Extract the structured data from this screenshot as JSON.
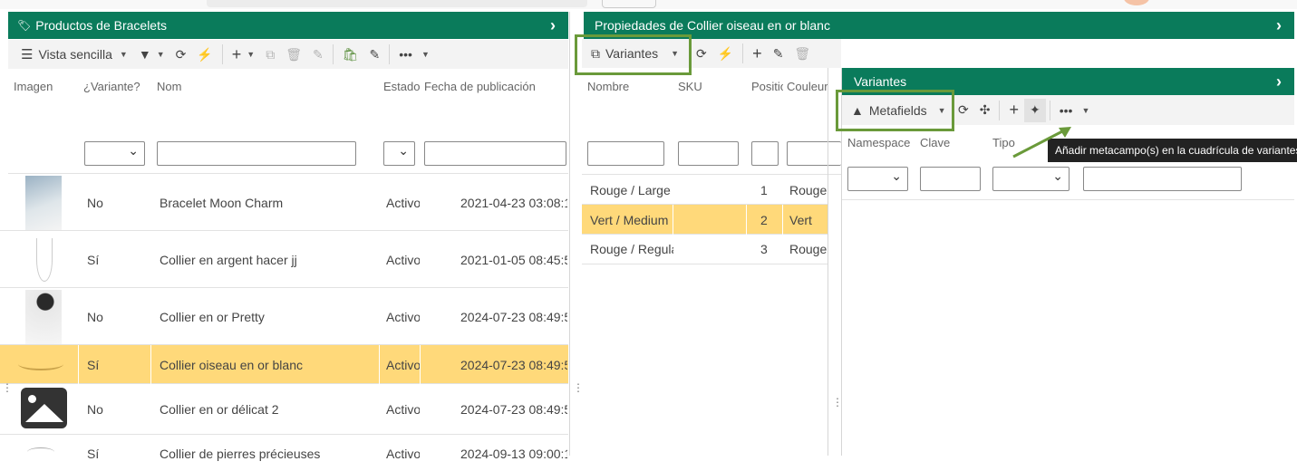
{
  "left_panel": {
    "title": "Productos de Bracelets",
    "toolbar": {
      "view_label": "Vista sencilla"
    },
    "columns": [
      "Imagen",
      "¿Variante?",
      "Nom",
      "Estado",
      "Fecha de publicación"
    ],
    "rows": [
      {
        "variant": "No",
        "name": "Bracelet Moon Charm",
        "status": "Activo",
        "date": "2021-04-23 03:08:1"
      },
      {
        "variant": "Sí",
        "name": "Collier en argent hacer jj",
        "status": "Activo",
        "date": "2021-01-05 08:45:5"
      },
      {
        "variant": "No",
        "name": "Collier en or Pretty",
        "status": "Activo",
        "date": "2024-07-23 08:49:5"
      },
      {
        "variant": "Sí",
        "name": "Collier oiseau en or blanc",
        "status": "Activo",
        "date": "2024-07-23 08:49:5"
      },
      {
        "variant": "No",
        "name": "Collier en or délicat 2",
        "status": "Activo",
        "date": "2024-07-23 08:49:5"
      },
      {
        "variant": "Sí",
        "name": "Collier de pierres précieuses",
        "status": "Activo",
        "date": "2024-09-13 09:00:1"
      }
    ]
  },
  "middle_panel": {
    "title": "Propiedades de Collier oiseau en or blanc",
    "toolbar": {
      "variants_label": "Variantes"
    },
    "columns": [
      "Nombre",
      "SKU",
      "Position",
      "Couleur"
    ],
    "rows": [
      {
        "name": "Rouge / Large",
        "sku": "",
        "position": "1",
        "color": "Rouge"
      },
      {
        "name": "Vert / Medium",
        "sku": "",
        "position": "2",
        "color": "Vert"
      },
      {
        "name": "Rouge / Regular",
        "sku": "",
        "position": "3",
        "color": "Rouge"
      }
    ]
  },
  "right_panel": {
    "title": "Variantes",
    "toolbar": {
      "metafields_label": "Metafields"
    },
    "columns": [
      "Namespace",
      "Clave",
      "Tipo"
    ],
    "tooltip": "Añadir metacampo(s) en la cuadrícula de variantes"
  },
  "colors": {
    "header_green": "#0a7b5b",
    "selected_row": "#ffd97a",
    "highlight_box": "#6a9a3a"
  }
}
